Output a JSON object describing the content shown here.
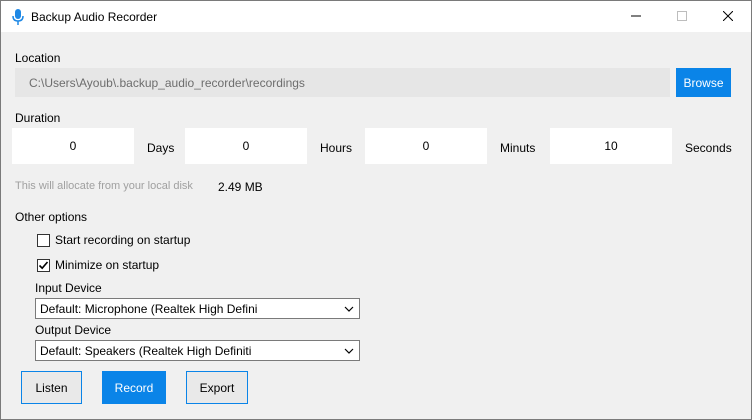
{
  "window": {
    "title": "Backup Audio Recorder",
    "icon": "microphone-icon",
    "controls": [
      "minimize-icon",
      "maximize-icon",
      "close-icon"
    ]
  },
  "location": {
    "label": "Location",
    "path": "C:\\Users\\Ayoub\\.backup_audio_recorder\\recordings",
    "browse_label": "Browse"
  },
  "duration": {
    "label": "Duration",
    "days": {
      "value": "0",
      "unit": "Days"
    },
    "hours": {
      "value": "0",
      "unit": "Hours"
    },
    "minutes": {
      "value": "0",
      "unit": "Minuts"
    },
    "seconds": {
      "value": "10",
      "unit": "Seconds"
    }
  },
  "allocation": {
    "hint": "This will allocate from your local disk",
    "size": "2.49 MB"
  },
  "options": {
    "label": "Other options",
    "start_on_startup": {
      "label": "Start recording on startup",
      "checked": false
    },
    "minimize_on_startup": {
      "label": "Minimize on startup",
      "checked": true
    },
    "input_device": {
      "label": "Input Device",
      "value": "Default: Microphone (Realtek High Defini"
    },
    "output_device": {
      "label": "Output Device",
      "value": "Default: Speakers (Realtek High Definiti"
    }
  },
  "actions": {
    "listen_label": "Listen",
    "record_label": "Record",
    "export_label": "Export"
  },
  "colors": {
    "accent": "#0a84e8",
    "background": "#f0f0f0",
    "hint_text": "#a0a0a0"
  }
}
